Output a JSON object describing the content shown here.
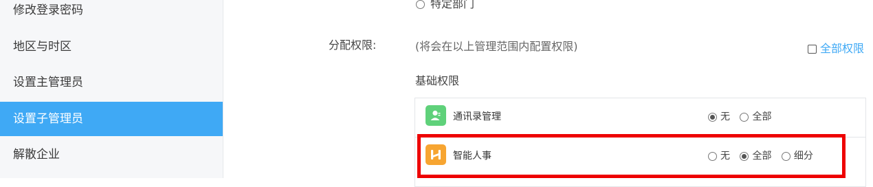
{
  "sidebar": {
    "items": [
      {
        "label": "修改登录密码"
      },
      {
        "label": "地区与时区"
      },
      {
        "label": "设置主管理员"
      },
      {
        "label": "设置子管理员",
        "active": true
      },
      {
        "label": "解散企业"
      }
    ]
  },
  "main": {
    "scope_partial_option": "特定部门",
    "assign_label": "分配权限:",
    "assign_hint": "(将会在以上管理范围内配置权限)",
    "all_permissions_label": "全部权限",
    "basic_section_title": "基础权限",
    "permissions": [
      {
        "name": "通讯录管理",
        "icon": "contacts-icon",
        "icon_color": "#5fd17a",
        "options": [
          "无",
          "全部"
        ],
        "selected": "无"
      },
      {
        "name": "智能人事",
        "icon": "smart-hr-icon",
        "icon_color": "#f7a531",
        "options": [
          "无",
          "全部",
          "细分"
        ],
        "selected": "全部"
      }
    ]
  },
  "colors": {
    "accent": "#3fa9f5",
    "highlight": "#ee0000"
  }
}
